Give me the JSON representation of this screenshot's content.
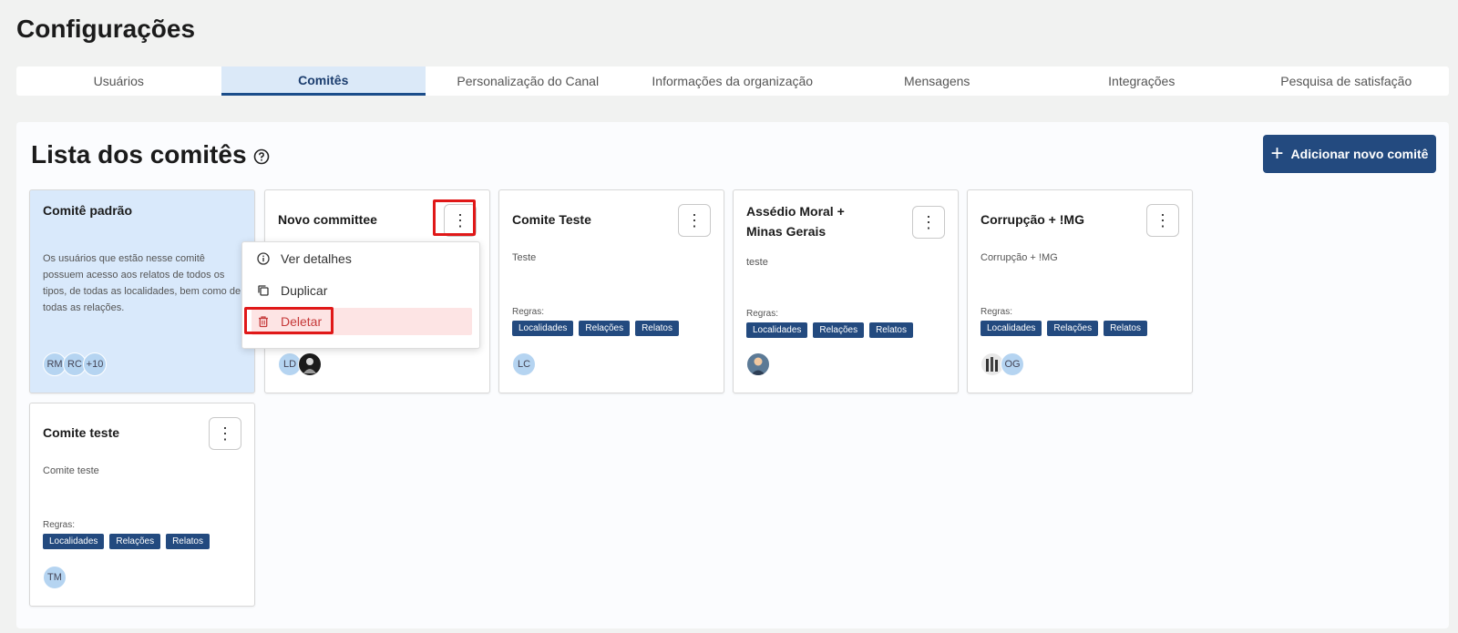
{
  "header": {
    "title": "Configurações"
  },
  "tabs": [
    {
      "label": "Usuários"
    },
    {
      "label": "Comitês"
    },
    {
      "label": "Personalização do Canal"
    },
    {
      "label": "Informações da organização"
    },
    {
      "label": "Mensagens"
    },
    {
      "label": "Integrações"
    },
    {
      "label": "Pesquisa de satisfação"
    }
  ],
  "list": {
    "title": "Lista dos comitês",
    "add_button": "Adicionar novo comitê"
  },
  "rules_label": "Regras:",
  "chip_labels": [
    "Localidades",
    "Relações",
    "Relatos"
  ],
  "cards": [
    {
      "title": "Comitê padrão",
      "description": "Os usuários que estão nesse comitê possuem acesso aos relatos de todos os tipos, de todas as localidades, bem como de todas as relações.",
      "avatars": [
        "RM",
        "RC",
        "+10"
      ]
    },
    {
      "title": "Novo committee",
      "avatars": [
        "LD"
      ]
    },
    {
      "title": "Comite Teste",
      "description": "Teste",
      "avatars": [
        "LC"
      ]
    },
    {
      "title": "Assédio Moral + Minas Gerais",
      "description": "teste"
    },
    {
      "title": "Corrupção + !MG",
      "description": "Corrupção + !MG",
      "avatars": [
        "OG"
      ]
    },
    {
      "title": "Comite teste",
      "description": "Comite teste",
      "avatars": [
        "TM"
      ]
    }
  ],
  "menu": {
    "view_details": "Ver detalhes",
    "duplicate": "Duplicar",
    "delete": "Deletar"
  },
  "colors": {
    "accent": "#234a7f",
    "default_card_bg": "#d9e9fb",
    "active_tab_bg": "#dbe9f8",
    "danger_bg": "#fde4e4",
    "highlight": "#e01818"
  }
}
